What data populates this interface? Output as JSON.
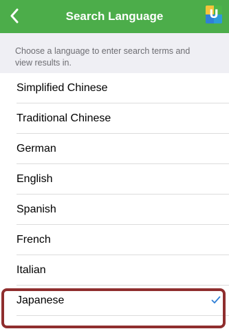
{
  "header": {
    "title": "Search Language",
    "back_icon": "chevron-left-icon",
    "logo_letter": "U",
    "background_color": "#4cad4a"
  },
  "description": "Choose a language to enter search terms and view results in.",
  "languages": [
    {
      "label": "Simplified Chinese",
      "selected": false
    },
    {
      "label": "Traditional Chinese",
      "selected": false
    },
    {
      "label": "German",
      "selected": false
    },
    {
      "label": "English",
      "selected": false
    },
    {
      "label": "Spanish",
      "selected": false
    },
    {
      "label": "French",
      "selected": false
    },
    {
      "label": "Italian",
      "selected": false
    },
    {
      "label": "Japanese",
      "selected": true
    }
  ],
  "colors": {
    "accent_check": "#2f7fd6",
    "highlight_frame": "#8f2e2e"
  }
}
